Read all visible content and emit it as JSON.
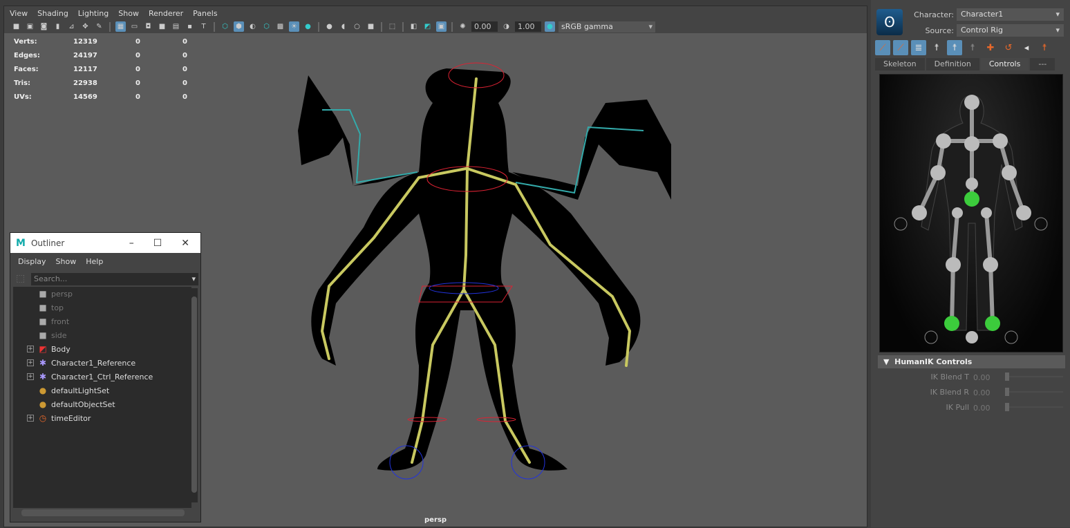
{
  "viewport": {
    "menu": [
      "View",
      "Shading",
      "Lighting",
      "Show",
      "Renderer",
      "Panels"
    ],
    "exposure": "0.00",
    "gamma": "1.00",
    "color_space": "sRGB gamma",
    "camera_label": "persp",
    "stats": [
      {
        "label": "Verts:",
        "values": [
          "12319",
          "0",
          "0"
        ]
      },
      {
        "label": "Edges:",
        "values": [
          "24197",
          "0",
          "0"
        ]
      },
      {
        "label": "Faces:",
        "values": [
          "12117",
          "0",
          "0"
        ]
      },
      {
        "label": "Tris:",
        "values": [
          "22938",
          "0",
          "0"
        ]
      },
      {
        "label": "UVs:",
        "values": [
          "14569",
          "0",
          "0"
        ]
      }
    ]
  },
  "outliner": {
    "title": "Outliner",
    "logo": "M",
    "menu": [
      "Display",
      "Show",
      "Help"
    ],
    "search_placeholder": "Search...",
    "items": [
      {
        "label": "persp",
        "icon": "camera-icon",
        "dim": true
      },
      {
        "label": "top",
        "icon": "camera-icon",
        "dim": true
      },
      {
        "label": "front",
        "icon": "camera-icon",
        "dim": true
      },
      {
        "label": "side",
        "icon": "camera-icon",
        "dim": true
      },
      {
        "label": "Body",
        "icon": "mesh-icon",
        "expand": true
      },
      {
        "label": "Character1_Reference",
        "icon": "character-icon",
        "expand": true
      },
      {
        "label": "Character1_Ctrl_Reference",
        "icon": "character-icon",
        "expand": true
      },
      {
        "label": "defaultLightSet",
        "icon": "set-icon"
      },
      {
        "label": "defaultObjectSet",
        "icon": "set-icon"
      },
      {
        "label": "timeEditor",
        "icon": "time-editor-icon",
        "expand": true
      }
    ]
  },
  "hik": {
    "character_label": "Character:",
    "character": "Character1",
    "source_label": "Source:",
    "source": "Control Rig",
    "tabs": [
      "Skeleton",
      "Definition",
      "Controls",
      "---"
    ],
    "active_tab": "Controls",
    "section": "HumanIK Controls",
    "controls": [
      {
        "label": "IK Blend T",
        "value": "0.00"
      },
      {
        "label": "IK Blend R",
        "value": "0.00"
      },
      {
        "label": "IK Pull",
        "value": "0.00"
      }
    ]
  },
  "colors": {
    "accent": "#5a8fb8",
    "bone": "#c8c860",
    "effector_green": "#3ccc3c"
  }
}
